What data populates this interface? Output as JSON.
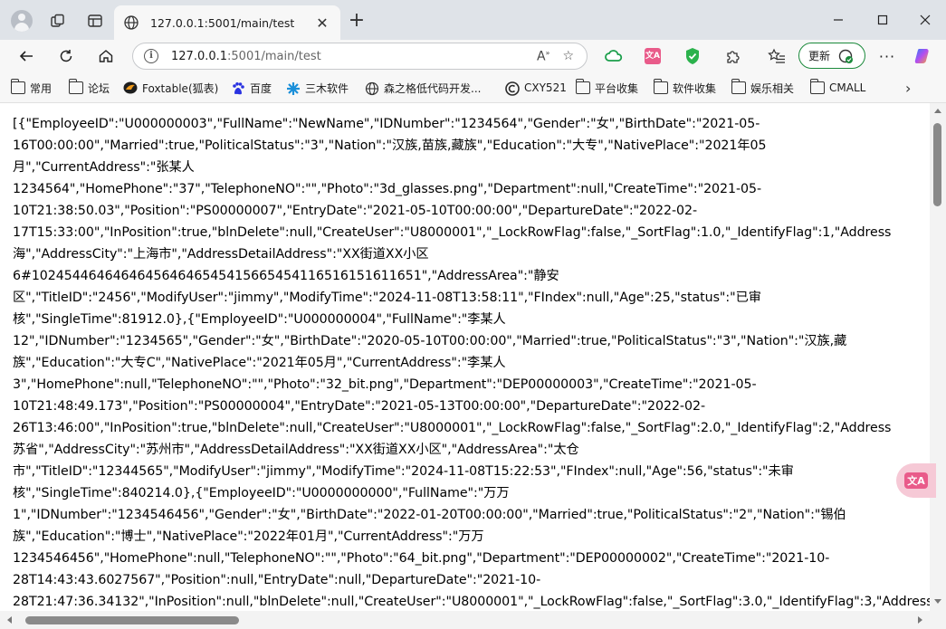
{
  "browser": {
    "tab_title": "127.0.0.1:5001/main/test",
    "address_host": "127.0.0.1",
    "address_rest": ":5001/main/test",
    "update_label": "更新",
    "colors": {
      "accent_green": "#1c8a3c",
      "tab_bg": "#f7f7f7",
      "frame_bg": "#dfe3e8"
    }
  },
  "bookmarks": [
    {
      "label": "常用",
      "icon": "folder-icon"
    },
    {
      "label": "论坛",
      "icon": "folder-icon"
    },
    {
      "label": "Foxtable(狐表)",
      "icon": "foxtable-icon"
    },
    {
      "label": "百度",
      "icon": "baidu-icon"
    },
    {
      "label": "三木软件",
      "icon": "sanmu-icon"
    },
    {
      "label": "森之格低代码开发...",
      "icon": "globe-icon"
    },
    {
      "label": "CXY521",
      "icon": "cxy-icon"
    },
    {
      "label": "平台收集",
      "icon": "folder-icon"
    },
    {
      "label": "软件收集",
      "icon": "folder-icon"
    },
    {
      "label": "娱乐相关",
      "icon": "folder-icon"
    },
    {
      "label": "CMALL",
      "icon": "folder-icon"
    }
  ],
  "content": {
    "lines": [
      "[{\"EmployeeID\":\"U000000003\",\"FullName\":\"NewName\",\"IDNumber\":\"1234564\",\"Gender\":\"女\",\"BirthDate\":\"2021-05-",
      "16T00:00:00\",\"Married\":true,\"PoliticalStatus\":\"3\",\"Nation\":\"汉族,苗族,藏族\",\"Education\":\"大专\",\"NativePlace\":\"2021年05",
      "月\",\"CurrentAddress\":\"张某人",
      "1234564\",\"HomePhone\":\"37\",\"TelephoneNO\":\"\",\"Photo\":\"3d_glasses.png\",\"Department\":null,\"CreateTime\":\"2021-05-",
      "10T21:38:50.03\",\"Position\":\"PS00000007\",\"EntryDate\":\"2021-05-10T00:00:00\",\"DepartureDate\":\"2022-02-",
      "17T15:33:00\",\"InPosition\":true,\"blnDelete\":null,\"CreateUser\":\"U8000001\",\"_LockRowFlag\":false,\"_SortFlag\":1.0,\"_IdentifyFlag\":1,\"Address",
      "海\",\"AddressCity\":\"上海市\",\"AddressDetailAddress\":\"XX街道XX小区",
      "6#102454464646464564646545415665454116516151611651\",\"AddressArea\":\"静安",
      "区\",\"TitleID\":\"2456\",\"ModifyUser\":\"jimmy\",\"ModifyTime\":\"2024-11-08T13:58:11\",\"FIndex\":null,\"Age\":25,\"status\":\"已审",
      "核\",\"SingleTime\":81912.0},{\"EmployeeID\":\"U000000004\",\"FullName\":\"李某人",
      "12\",\"IDNumber\":\"1234565\",\"Gender\":\"女\",\"BirthDate\":\"2020-05-10T00:00:00\",\"Married\":true,\"PoliticalStatus\":\"3\",\"Nation\":\"汉族,藏",
      "族\",\"Education\":\"大专C\",\"NativePlace\":\"2021年05月\",\"CurrentAddress\":\"李某人",
      "3\",\"HomePhone\":null,\"TelephoneNO\":\"\",\"Photo\":\"32_bit.png\",\"Department\":\"DEP00000003\",\"CreateTime\":\"2021-05-",
      "10T21:48:49.173\",\"Position\":\"PS00000004\",\"EntryDate\":\"2021-05-13T00:00:00\",\"DepartureDate\":\"2022-02-",
      "26T13:46:00\",\"InPosition\":true,\"blnDelete\":null,\"CreateUser\":\"U8000001\",\"_LockRowFlag\":false,\"_SortFlag\":2.0,\"_IdentifyFlag\":2,\"Address",
      "苏省\",\"AddressCity\":\"苏州市\",\"AddressDetailAddress\":\"XX街道XX小区\",\"AddressArea\":\"太仓",
      "市\",\"TitleID\":\"12344565\",\"ModifyUser\":\"jimmy\",\"ModifyTime\":\"2024-11-08T15:22:53\",\"FIndex\":null,\"Age\":56,\"status\":\"未审",
      "核\",\"SingleTime\":840214.0},{\"EmployeeID\":\"U0000000000\",\"FullName\":\"万万",
      "1\",\"IDNumber\":\"1234546456\",\"Gender\":\"女\",\"BirthDate\":\"2022-01-20T00:00:00\",\"Married\":true,\"PoliticalStatus\":\"2\",\"Nation\":\"锡伯",
      "族\",\"Education\":\"博士\",\"NativePlace\":\"2022年01月\",\"CurrentAddress\":\"万万",
      "1234546456\",\"HomePhone\":null,\"TelephoneNO\":\"\",\"Photo\":\"64_bit.png\",\"Department\":\"DEP00000002\",\"CreateTime\":\"2021-10-",
      "28T14:43:43.6027567\",\"Position\":null,\"EntryDate\":null,\"DepartureDate\":\"2021-10-",
      "28T21:47:36.34132\",\"InPosition\":null,\"blnDelete\":null,\"CreateUser\":\"U8000001\",\"_LockRowFlag\":false,\"_SortFlag\":3.0,\"_IdentifyFlag\":3,\"Address"
    ]
  }
}
